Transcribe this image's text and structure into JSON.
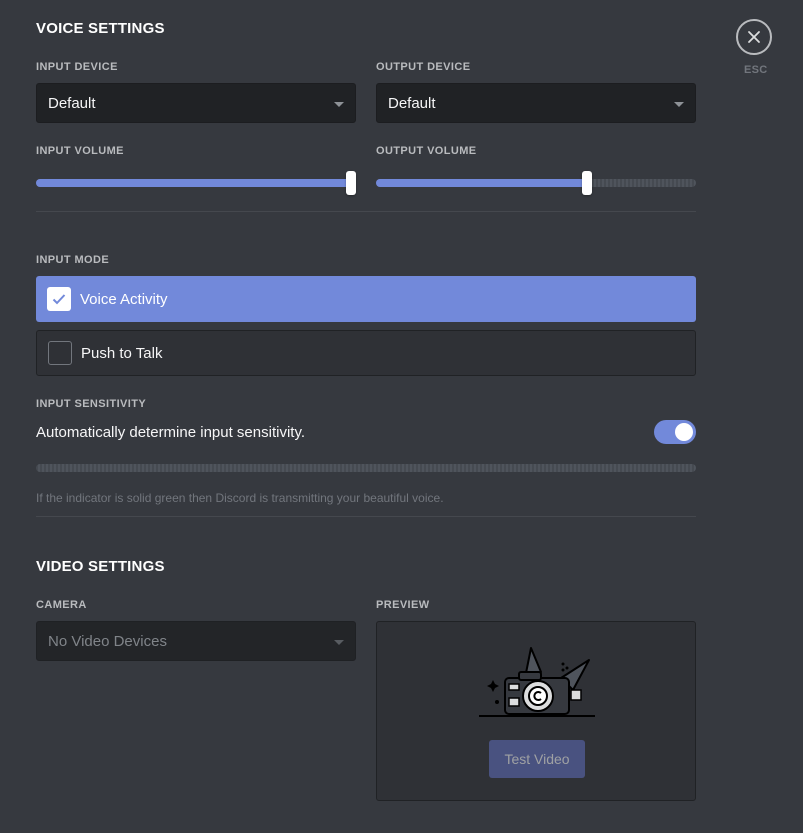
{
  "voice": {
    "title": "VOICE SETTINGS",
    "input_device_label": "INPUT DEVICE",
    "input_device_value": "Default",
    "output_device_label": "OUTPUT DEVICE",
    "output_device_value": "Default",
    "input_volume_label": "INPUT VOLUME",
    "input_volume_level": 1.0,
    "output_volume_label": "OUTPUT VOLUME",
    "output_volume_level": 0.66
  },
  "input_mode": {
    "label": "INPUT MODE",
    "options": [
      {
        "label": "Voice Activity",
        "selected": true
      },
      {
        "label": "Push to Talk",
        "selected": false
      }
    ]
  },
  "sensitivity": {
    "label": "INPUT SENSITIVITY",
    "auto_label": "Automatically determine input sensitivity.",
    "auto_enabled": true,
    "hint": "If the indicator is solid green then Discord is transmitting your beautiful voice."
  },
  "video": {
    "title": "VIDEO SETTINGS",
    "camera_label": "CAMERA",
    "camera_value": "No Video Devices",
    "preview_label": "PREVIEW",
    "test_button": "Test Video"
  },
  "close": {
    "esc_label": "ESC"
  },
  "colors": {
    "background": "#36393f",
    "accent": "#7289da",
    "input_bg": "#202225"
  }
}
